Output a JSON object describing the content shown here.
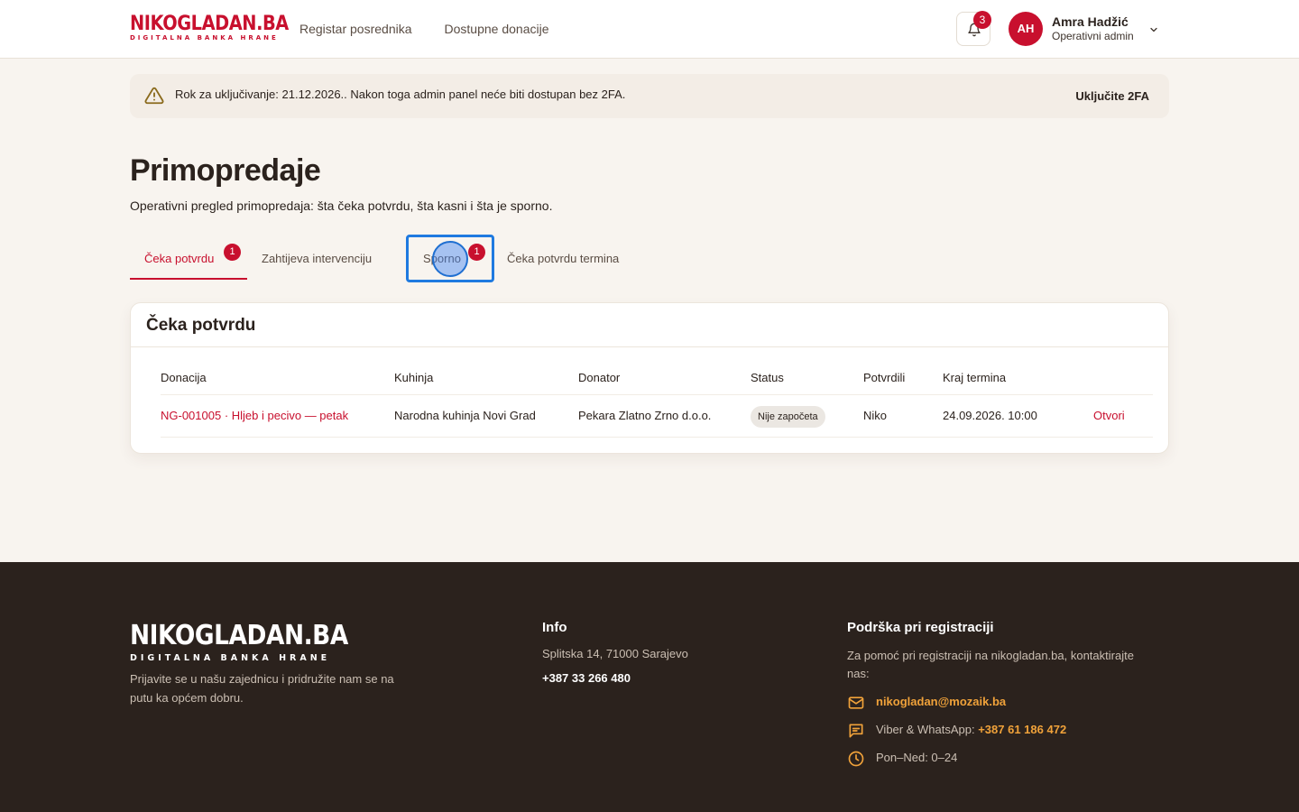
{
  "brand": {
    "name_red": "NIKO",
    "name_dark": "GLADAN.BA",
    "tagline": "DIGITALNA BANKA HRANE"
  },
  "nav": {
    "items": [
      {
        "label": "Registar posrednika"
      },
      {
        "label": "Dostupne donacije"
      }
    ]
  },
  "notifications": {
    "count": "3"
  },
  "user": {
    "initials": "AH",
    "name": "Amra Hadžić",
    "role": "Operativni admin"
  },
  "alert": {
    "text": "Rok za uključivanje: 21.12.2026.. Nakon toga admin panel neće biti dostupan bez 2FA.",
    "action": "Uključite 2FA"
  },
  "page": {
    "title": "Primopredaje",
    "subtitle": "Operativni pregled primopredaja: šta čeka potvrdu, šta kasni i šta je sporno."
  },
  "tabs": [
    {
      "label": "Čeka potvrdu",
      "badge": "1",
      "active": true
    },
    {
      "label": "Zahtijeva intervenciju",
      "badge": "",
      "active": false
    },
    {
      "label": "Sporno",
      "badge": "1",
      "active": false
    },
    {
      "label": "Čeka potvrdu termina",
      "badge": "",
      "active": false
    }
  ],
  "card": {
    "title": "Čeka potvrdu",
    "columns": [
      "Donacija",
      "Kuhinja",
      "Donator",
      "Status",
      "Potvrdili",
      "Kraj termina"
    ],
    "rows": [
      {
        "donation": "NG-001005 · Hljeb i pecivo — petak",
        "kitchen": "Narodna kuhinja Novi Grad",
        "donor": "Pekara Zlatno Zrno d.o.o.",
        "status": "Nije započeta",
        "confirmed_by": "Niko",
        "end": "24.09.2026. 10:00",
        "action": "Otvori"
      }
    ]
  },
  "footer": {
    "description": "Prijavite se u našu zajednicu i pridružite nam se na putu ka općem dobru.",
    "info": {
      "heading": "Info",
      "address": "Splitska 14, 71000 Sarajevo",
      "phone": "+387 33 266 480"
    },
    "support": {
      "heading": "Podrška pri registraciji",
      "text": "Za pomoć pri registraciji na nikogladan.ba, kontaktirajte nas:",
      "email": "nikogladan@mozaik.ba",
      "viber_label": "Viber & WhatsApp: ",
      "viber_number": "+387 61 186 472",
      "hours": "Pon–Ned: 0–24"
    }
  },
  "colors": {
    "accent": "#c8102e",
    "footer_bg": "#2b221d",
    "page_bg": "#f8f4ef",
    "link_orange": "#f0a23a"
  }
}
